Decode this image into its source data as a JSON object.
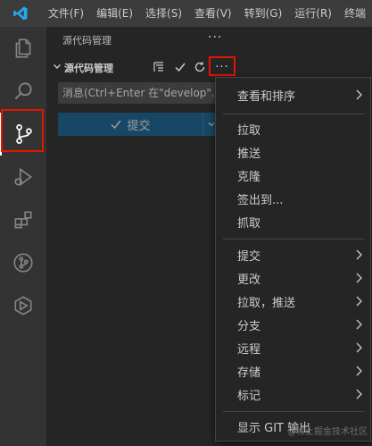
{
  "titlebar": {
    "menu": [
      "文件(F)",
      "编辑(E)",
      "选择(S)",
      "查看(V)",
      "转到(G)",
      "运行(R)",
      "终端"
    ]
  },
  "activitybar": {
    "items": [
      "files-icon",
      "search-icon",
      "source-control-icon",
      "run-debug-icon",
      "extensions-icon",
      "git-graph-icon",
      "remote-icon"
    ],
    "active": "source-control-icon"
  },
  "sidebar": {
    "title": "源代码管理",
    "more": "···",
    "section": {
      "title": "源代码管理",
      "more": "···"
    },
    "message_input": {
      "placeholder": "消息(Ctrl+Enter 在\"develop\"..."
    },
    "commit_button": "提交"
  },
  "context_menu": {
    "items": [
      {
        "label": "查看和排序",
        "submenu": true
      },
      {
        "label": "拉取",
        "submenu": false
      },
      {
        "label": "推送",
        "submenu": false
      },
      {
        "label": "克隆",
        "submenu": false
      },
      {
        "label": "签出到...",
        "submenu": false
      },
      {
        "label": "抓取",
        "submenu": false
      },
      {
        "label": "提交",
        "submenu": true
      },
      {
        "label": "更改",
        "submenu": true
      },
      {
        "label": "拉取，推送",
        "submenu": true
      },
      {
        "label": "分支",
        "submenu": true
      },
      {
        "label": "远程",
        "submenu": true
      },
      {
        "label": "存储",
        "submenu": true
      },
      {
        "label": "标记",
        "submenu": true
      },
      {
        "label": "显示 GIT 输出",
        "submenu": false
      }
    ]
  },
  "watermark": "@稀土掘金技术社区",
  "colors": {
    "accent": "#0e639c",
    "highlight": "#e51400",
    "vscode_blue": "#23a9f2"
  }
}
